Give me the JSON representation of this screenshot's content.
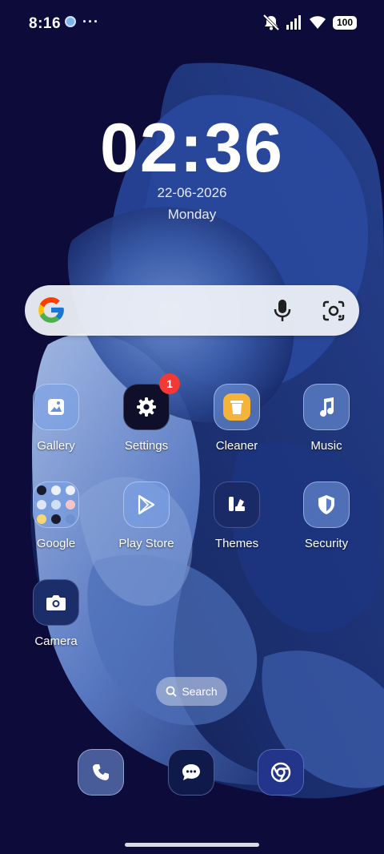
{
  "status_bar": {
    "time": "8:16",
    "more": "···",
    "battery": "100",
    "icons": [
      "app-status-icon",
      "silent-mode-icon",
      "signal-icon",
      "wifi-icon",
      "battery-icon"
    ]
  },
  "clock": {
    "time": "02:36",
    "date": "22-06-2026",
    "day": "Monday"
  },
  "search_widget": {
    "logo": "google-logo",
    "mic": "mic-icon",
    "lens": "lens-icon"
  },
  "apps": [
    {
      "label": "Gallery",
      "icon": "gallery-icon"
    },
    {
      "label": "Settings",
      "icon": "gear-icon",
      "badge": "1"
    },
    {
      "label": "Cleaner",
      "icon": "trash-icon"
    },
    {
      "label": "Music",
      "icon": "music-note-icon"
    },
    {
      "label": "Google",
      "icon": "folder-icon"
    },
    {
      "label": "Play Store",
      "icon": "play-store-icon"
    },
    {
      "label": "Themes",
      "icon": "themes-icon"
    },
    {
      "label": "Security",
      "icon": "shield-icon"
    },
    {
      "label": "Camera",
      "icon": "camera-icon"
    }
  ],
  "search_pill": {
    "label": "Search"
  },
  "dock": [
    {
      "name": "phone",
      "icon": "phone-icon"
    },
    {
      "name": "messages",
      "icon": "message-icon"
    },
    {
      "name": "chrome",
      "icon": "chrome-icon"
    }
  ],
  "colors": {
    "background": "#0d0b3a",
    "badge": "#f03a33",
    "accent_glass": "#7aa0e6",
    "cleaner_yellow": "#f4b43a"
  }
}
